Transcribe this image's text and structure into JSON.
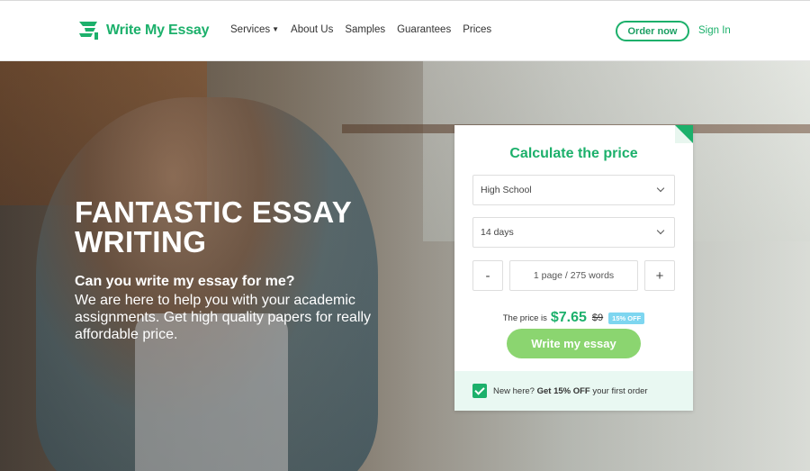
{
  "brand": {
    "name": "Write My Essay",
    "color": "#1cb06b",
    "icon": "essay-logo-icon"
  },
  "nav": {
    "items": [
      {
        "label": "Services",
        "has_dropdown": true
      },
      {
        "label": "About Us"
      },
      {
        "label": "Samples"
      },
      {
        "label": "Guarantees"
      },
      {
        "label": "Prices"
      }
    ]
  },
  "header": {
    "order_label": "Order now",
    "signin_label": "Sign In"
  },
  "hero": {
    "headline_line1": "FANTASTIC ESSAY",
    "headline_line2": "WRITING",
    "subhead": "Can you write my essay for me?",
    "description": "We are here to help you with your academic assignments. Get high quality papers for really affordable price."
  },
  "calculator": {
    "title": "Calculate the price",
    "level_select": "High School",
    "deadline_select": "14 days",
    "minus_label": "-",
    "plus_label": "+",
    "pages_value": "1 page / 275 words",
    "price_label": "The price is",
    "price": "$7.65",
    "old_price": "$9",
    "discount_badge": "15% OFF",
    "cta_label": "Write my essay",
    "new_prefix": "New here?",
    "new_bold": "Get 15% OFF",
    "new_suffix": "your first order",
    "checkbox_checked": true
  }
}
